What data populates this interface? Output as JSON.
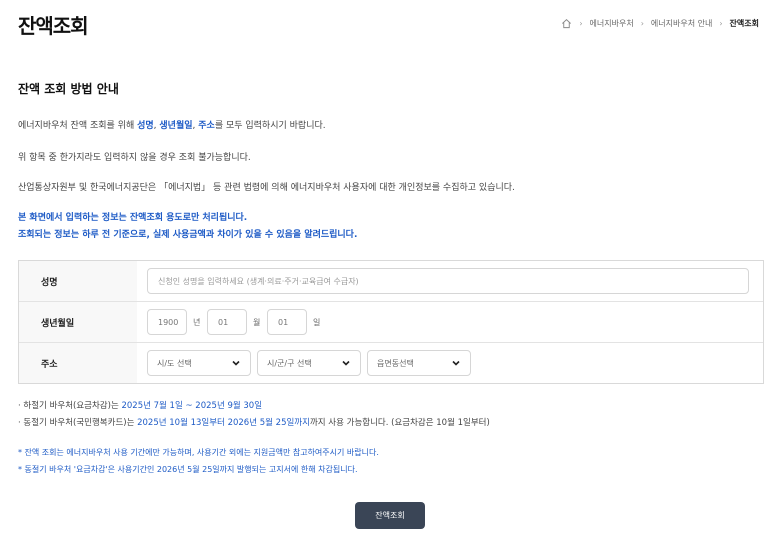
{
  "header": {
    "title": "잔액조회",
    "breadcrumb": [
      "에너지바우처",
      "에너지바우처 안내",
      "잔액조회"
    ]
  },
  "guide": {
    "title": "잔액 조회 방법 안내",
    "line1_prefix": "에너지바우처 잔액 조회를 위해 ",
    "line1_name": "성명",
    "line1_birth": "생년월일",
    "line1_addr": "주소",
    "line1_suffix": "를 모두 입력하시기 바랍니다.",
    "line2": "위 항목 중 한가지라도 입력하지 않을 경우 조회 불가능합니다.",
    "line3": "산업통상자원부 및 한국에너지공단은 「에너지법」 등 관련 법령에 의해 에너지바우처 사용자에 대한 개인정보를 수집하고 있습니다.",
    "notice1": "본 화면에서 입력하는 정보는 잔액조회 용도로만 처리됩니다.",
    "notice2": "조회되는 정보는 하루 전 기준으로, 실제 사용금액과 차이가 있을 수 있음을 알려드립니다."
  },
  "form": {
    "name_label": "성명",
    "name_placeholder": "신청인 성명을 입력하세요 (생계·의료·주거·교육급여 수급자)",
    "birth_label": "생년월일",
    "year_value": "1900",
    "year_unit": "년",
    "month_value": "01",
    "month_unit": "월",
    "day_value": "01",
    "day_unit": "일",
    "addr_label": "주소",
    "sido_selected": "시/도 선택",
    "sigungu_selected": "시/군/구 선택",
    "dong_selected": "읍면동선택"
  },
  "info": {
    "summer_prefix": "· 하절기 바우처(요금차감)는 ",
    "summer_period": "2025년 7월 1일 ~ 2025년 9월 30일",
    "winter_prefix": "· 동절기 바우처(국민행복카드)는 ",
    "winter_period": "2025년 10월 13일부터 2026년 5월 25일까지",
    "winter_suffix": "까지 사용 가능합니다. (요금차감은 10월 1일부터)",
    "warn1": "* 잔액 조회는 에너지바우처 사용 기간에만 가능하며, 사용기간 외에는 지원금액만 참고하여주시기 바랍니다.",
    "warn2": "* 동절기 바우처 '요금차감'은 사용기간인 2026년 5월 25일까지 발행되는 고지서에 한해 차감됩니다."
  },
  "submit_label": "잔액조회",
  "colors": {
    "accent": "#1e5bc6",
    "button": "#3a4556"
  }
}
